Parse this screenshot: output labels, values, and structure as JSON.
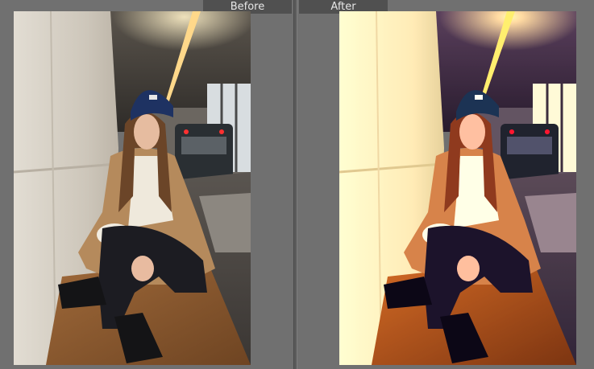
{
  "labels": {
    "before": "Before",
    "after": "After"
  },
  "colors": {
    "background": "#6f6f6f",
    "label_bg": "#505050",
    "label_text": "#e6e6e6",
    "beanie": "#1e3262",
    "coat": "#b58a5c",
    "sweater": "#efe9dc",
    "pants": "#1c1c22",
    "bench": "#8e5e32",
    "wall_before": "#d9d3c8",
    "wall_after": "#e6e4c9",
    "ceiling_before": "#3e3a36",
    "ceiling_after": "#3c2b3b",
    "train": "#2a2f33",
    "train_light": "#ff2a2a",
    "ceiling_light": "#ffd46a"
  }
}
